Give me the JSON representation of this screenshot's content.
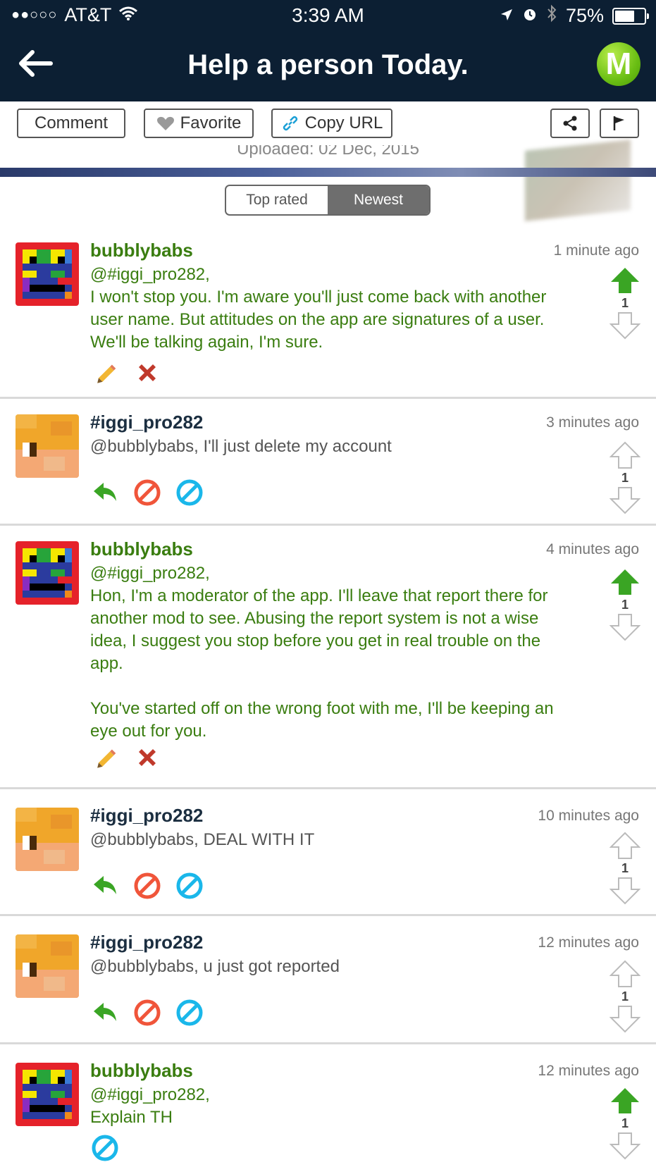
{
  "status_bar": {
    "carrier": "AT&T",
    "signal": "●●○○○",
    "time": "3:39 AM",
    "battery": "75%",
    "battery_level": 0.75
  },
  "nav": {
    "title": "Help a person Today.",
    "logo_letter": "M"
  },
  "toolbar": {
    "comment_label": "Comment",
    "favorite_label": "Favorite",
    "copy_url_label": "Copy URL"
  },
  "uploaded": "Uploaded: 02 Dec, 2015",
  "sort_tabs": [
    "Top rated",
    "Newest"
  ],
  "active_sort": "Newest",
  "comments": [
    {
      "user": "bubblybabs",
      "time": "1 minute ago",
      "text": "@#iggi_pro282,\nI won't stop you. I'm aware you'll just come back with another user name. But attitudes on the app are signatures of a user. We'll be talking again, I'm sure.",
      "votes": "1"
    },
    {
      "user": "#iggi_pro282",
      "time": "3 minutes ago",
      "text": "@bubblybabs, I'll just delete my account",
      "votes": "1"
    },
    {
      "user": "bubblybabs",
      "time": "4 minutes ago",
      "text": "@#iggi_pro282,\nHon, I'm a moderator of the app. I'll leave that report there for another mod to see. Abusing the report system is not a wise idea, I suggest you stop before you get in real trouble on the app.\n\nYou've started off on the wrong foot with me, I'll be keeping an eye out for you.",
      "votes": "1"
    },
    {
      "user": "#iggi_pro282",
      "time": "10 minutes ago",
      "text": "@bubblybabs, DEAL WITH IT",
      "votes": "1"
    },
    {
      "user": "#iggi_pro282",
      "time": "12 minutes ago",
      "text": "@bubblybabs, u just got reported",
      "votes": "1"
    },
    {
      "user": "bubblybabs",
      "time": "12 minutes ago",
      "text": "@#iggi_pro282,\nExplain TH",
      "votes": "1"
    }
  ],
  "colors": {
    "nav_bg": "#0c1f33",
    "moderator_green": "#3a7d10",
    "upvote_green": "#3aa524",
    "reply_green": "#3aa524",
    "block_red": "#f0553a",
    "ban_blue": "#1ab7ea",
    "delete_red": "#c0392b"
  }
}
